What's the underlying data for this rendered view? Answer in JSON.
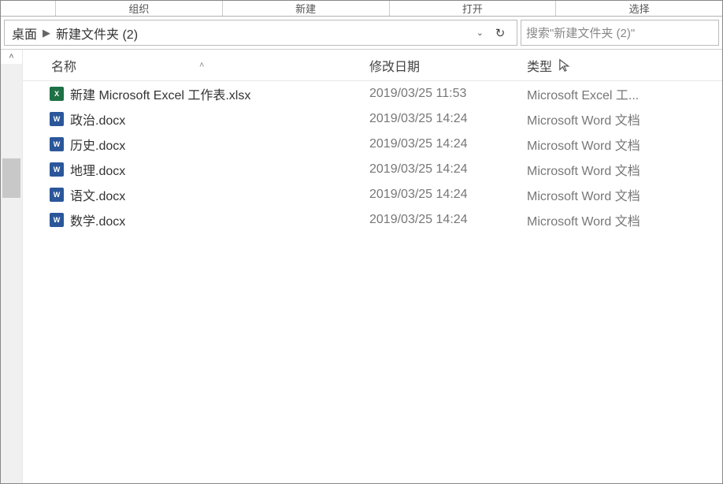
{
  "ribbon_groups": [
    "组织",
    "新建",
    "打开",
    "选择"
  ],
  "breadcrumb": {
    "item0": "桌面",
    "item1": "新建文件夹 (2)"
  },
  "search_placeholder": "搜索\"新建文件夹 (2)\"",
  "columns": {
    "name": "名称",
    "date": "修改日期",
    "type": "类型"
  },
  "files": [
    {
      "name": "新建 Microsoft Excel 工作表.xlsx",
      "date": "2019/03/25 11:53",
      "type": "Microsoft Excel 工...",
      "icon": "excel"
    },
    {
      "name": "政治.docx",
      "date": "2019/03/25 14:24",
      "type": "Microsoft Word 文档",
      "icon": "word"
    },
    {
      "name": "历史.docx",
      "date": "2019/03/25 14:24",
      "type": "Microsoft Word 文档",
      "icon": "word"
    },
    {
      "name": "地理.docx",
      "date": "2019/03/25 14:24",
      "type": "Microsoft Word 文档",
      "icon": "word"
    },
    {
      "name": "语文.docx",
      "date": "2019/03/25 14:24",
      "type": "Microsoft Word 文档",
      "icon": "word"
    },
    {
      "name": "数学.docx",
      "date": "2019/03/25 14:24",
      "type": "Microsoft Word 文档",
      "icon": "word"
    }
  ]
}
